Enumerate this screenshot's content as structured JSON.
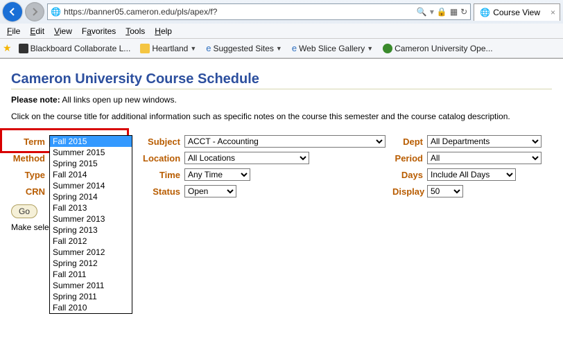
{
  "browser": {
    "url": "https://banner05.cameron.edu/pls/apex/f?",
    "tab_title": "Course View"
  },
  "menu": {
    "file": "File",
    "edit": "Edit",
    "view": "View",
    "favorites": "Favorites",
    "tools": "Tools",
    "help": "Help"
  },
  "favbar": {
    "bb": "Blackboard Collaborate  L...",
    "heartland": "Heartland",
    "suggested": "Suggested Sites",
    "webslice": "Web Slice Gallery",
    "cameron": "Cameron University  Ope..."
  },
  "page": {
    "title": "Cameron University Course Schedule",
    "note_bold": "Please note:",
    "note_rest": " All links open up new windows.",
    "desc": "Click on the course title for additional information such as specific notes on the course this semester and the course catalog description."
  },
  "labels": {
    "term": "Term",
    "subject": "Subject",
    "dept": "Dept",
    "method": "Method",
    "location": "Location",
    "period": "Period",
    "type": "Type",
    "time": "Time",
    "days": "Days",
    "crn": "CRN",
    "status": "Status",
    "display": "Display",
    "go": "Go",
    "make_sel": "Make sele"
  },
  "selects": {
    "term": "Fall 2015",
    "subject": "ACCT - Accounting",
    "dept": "All Departments",
    "location": "All Locations",
    "period": "All",
    "time": "Any Time",
    "days": "Include All Days",
    "status": "Open",
    "display": "50"
  },
  "term_options": [
    "Fall 2015",
    "Summer 2015",
    "Spring 2015",
    "Fall 2014",
    "Summer 2014",
    "Spring 2014",
    "Fall 2013",
    "Summer 2013",
    "Spring 2013",
    "Fall 2012",
    "Summer 2012",
    "Spring 2012",
    "Fall 2011",
    "Summer 2011",
    "Spring 2011",
    "Fall 2010"
  ]
}
